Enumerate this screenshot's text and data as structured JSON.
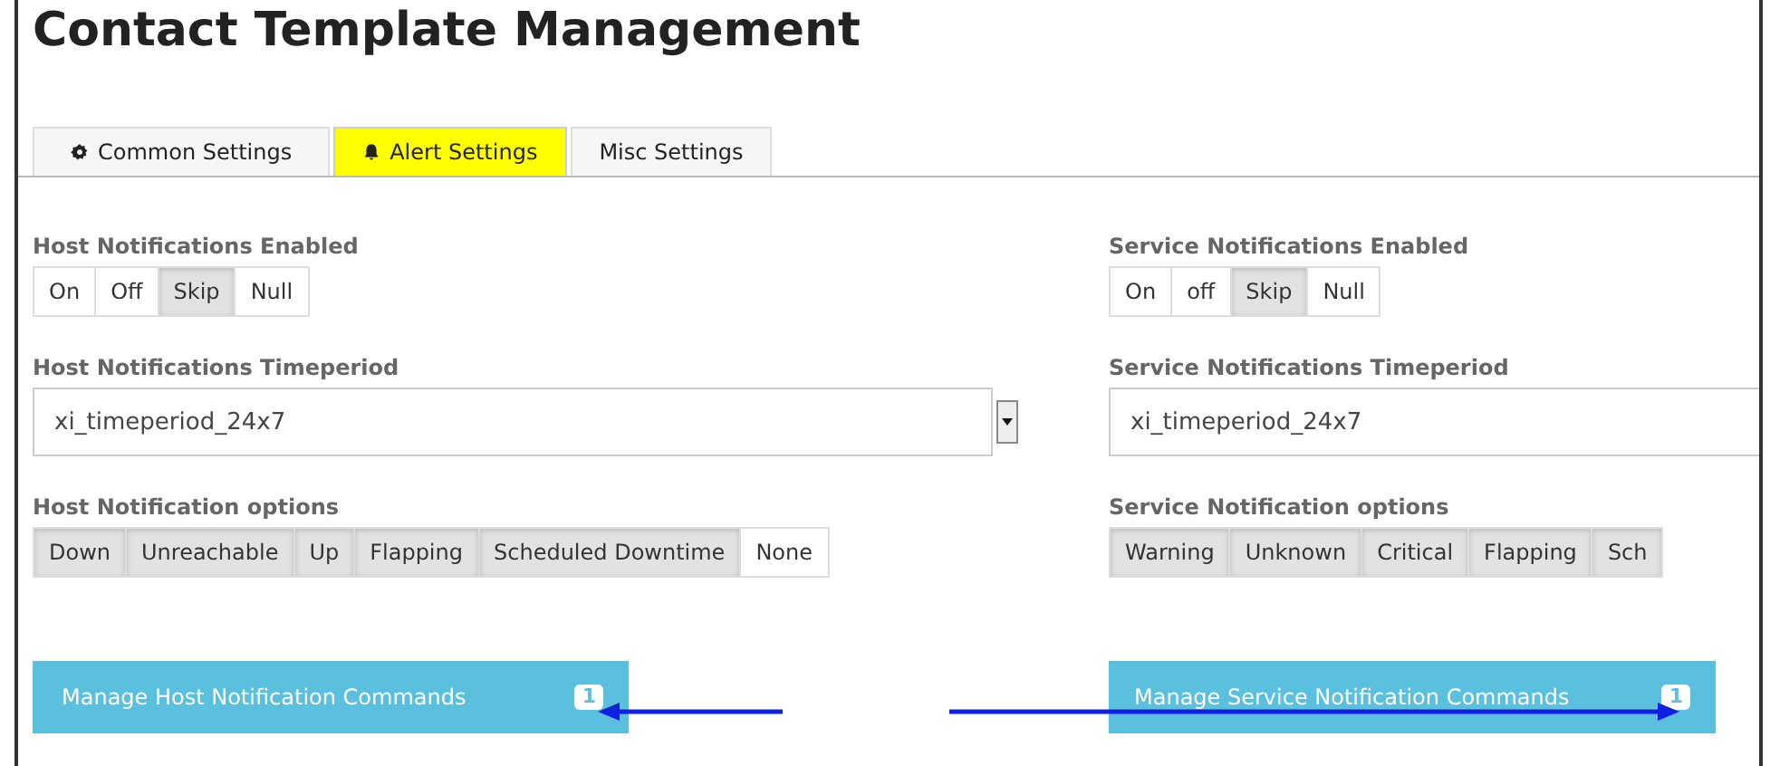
{
  "title": "Contact Template Management",
  "tabs": [
    {
      "label": "Common Settings",
      "kind": "gear",
      "selected": false
    },
    {
      "label": "Alert Settings",
      "kind": "bell",
      "selected": true
    },
    {
      "label": "Misc Settings",
      "selected": false
    }
  ],
  "columns": [
    {
      "enabled": {
        "label": "Host Notifications Enabled",
        "options": [
          {
            "label": "On",
            "selected": false
          },
          {
            "label": "Off",
            "selected": false
          },
          {
            "label": "Skip",
            "selected": true
          },
          {
            "label": "Null",
            "selected": false
          }
        ]
      },
      "timeperiod": {
        "label": "Host Notifications Timeperiod",
        "value": "xi_timeperiod_24x7",
        "dropdown": true
      },
      "options": {
        "label": "Host Notification options",
        "items": [
          {
            "label": "Down",
            "selected": true
          },
          {
            "label": "Unreachable",
            "selected": true
          },
          {
            "label": "Up",
            "selected": true
          },
          {
            "label": "Flapping",
            "selected": true
          },
          {
            "label": "Scheduled Downtime",
            "selected": true
          },
          {
            "label": "None",
            "selected": false
          }
        ]
      },
      "commands": {
        "label": "Manage Host Notification Commands",
        "count": "1"
      }
    },
    {
      "enabled": {
        "label": "Service Notifications Enabled",
        "options": [
          {
            "label": "On",
            "selected": false
          },
          {
            "label": "off",
            "selected": false
          },
          {
            "label": "Skip",
            "selected": true
          },
          {
            "label": "Null",
            "selected": false
          }
        ]
      },
      "timeperiod": {
        "label": "Service Notifications Timeperiod",
        "value": "xi_timeperiod_24x7"
      },
      "options": {
        "label": "Service Notification options",
        "items": [
          {
            "label": "Warning",
            "selected": true
          },
          {
            "label": "Unknown",
            "selected": true
          },
          {
            "label": "Critical",
            "selected": true
          },
          {
            "label": "Flapping",
            "selected": true
          },
          {
            "label": "Sch",
            "selected": true
          }
        ]
      },
      "commands": {
        "label": "Manage Service Notification Commands",
        "count": "1"
      }
    }
  ]
}
